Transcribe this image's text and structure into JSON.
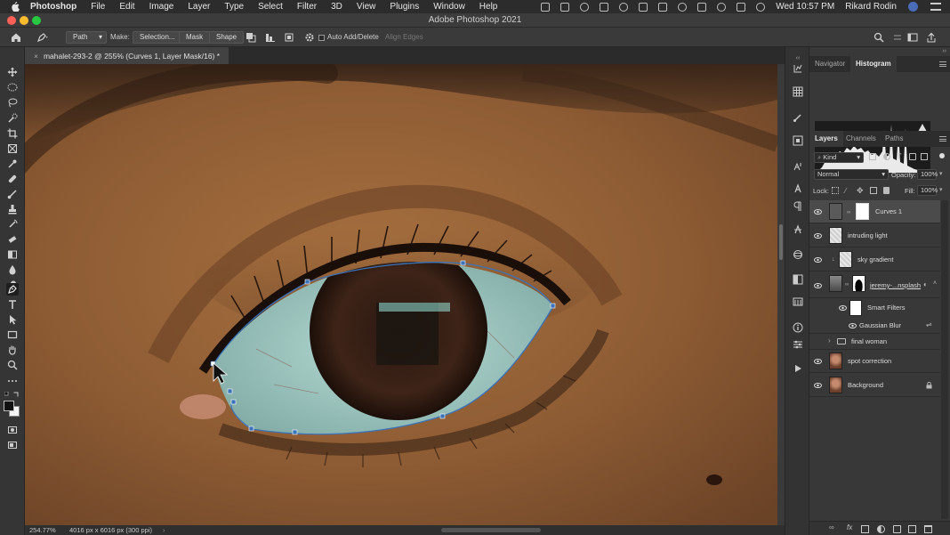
{
  "menubar": {
    "app_name": "Photoshop",
    "items": [
      "File",
      "Edit",
      "Image",
      "Layer",
      "Type",
      "Select",
      "Filter",
      "3D",
      "View",
      "Plugins",
      "Window",
      "Help"
    ],
    "clock": "Wed 10:57 PM",
    "user": "Rikard Rodin"
  },
  "titlebar": {
    "title": "Adobe Photoshop 2021"
  },
  "options": {
    "mode_value": "Path",
    "make_label": "Make:",
    "selection_btn": "Selection...",
    "mask_btn": "Mask",
    "shape_btn": "Shape",
    "auto_add_delete_label": "Auto Add/Delete",
    "align_edges_label": "Align Edges"
  },
  "document": {
    "tab_title": "mahalet-293-2 @ 255% (Curves 1, Layer Mask/16) *"
  },
  "status": {
    "zoom": "254.77%",
    "doc_size": "4016 px x 6016 px (300 ppi)"
  },
  "panels": {
    "top_tabs": [
      "Navigator",
      "Histogram"
    ],
    "top_active": "Histogram",
    "layer_tabs": [
      "Layers",
      "Channels",
      "Paths"
    ],
    "layer_active": "Layers",
    "filter_kind": "Kind",
    "blend_mode": "Normal",
    "opacity_label": "Opacity:",
    "opacity_value": "100%",
    "lock_label": "Lock:",
    "fill_label": "Fill:",
    "fill_value": "100%"
  },
  "layers": [
    {
      "name": "Curves 1"
    },
    {
      "name": "intruding light"
    },
    {
      "name": "sky gradient"
    },
    {
      "name": "jeremy-...nsplash"
    },
    {
      "name": "Smart Filters"
    },
    {
      "name": "Gaussian Blur"
    },
    {
      "name": "final woman"
    },
    {
      "name": "spot correction"
    },
    {
      "name": "Background"
    }
  ],
  "colors": {
    "path_stroke": "#3b73b8",
    "accent_blue": "#2f6fcf",
    "skin": "#8a5a36",
    "sclera_tint": "#9fc9c4"
  }
}
